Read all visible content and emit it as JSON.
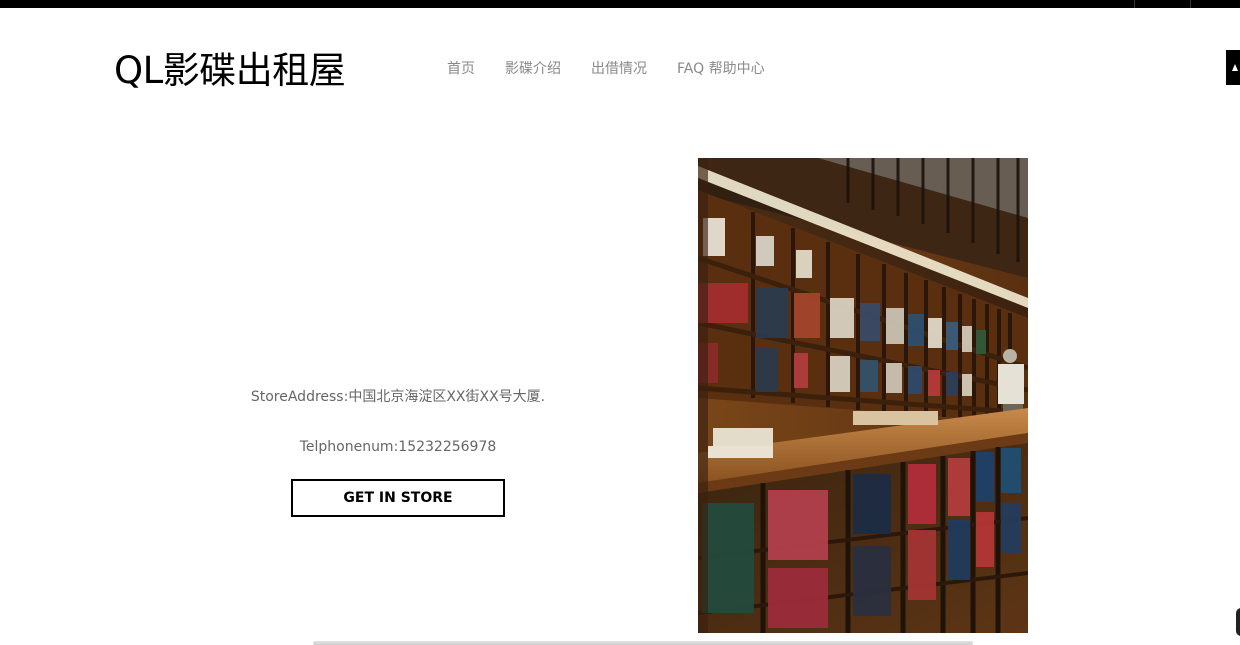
{
  "header": {
    "logo_text": "QL影碟出租屋",
    "nav": [
      "首页",
      "影碟介绍",
      "出借情况",
      "FAQ 帮助中心"
    ]
  },
  "store": {
    "address": "StoreAddress:中国北京海淀区XX街XX号大厦.",
    "phone": "Telphonenum:15232256978",
    "cta_label": "GET IN STORE"
  },
  "image": {
    "subject": "library-bookshelves-photo"
  }
}
